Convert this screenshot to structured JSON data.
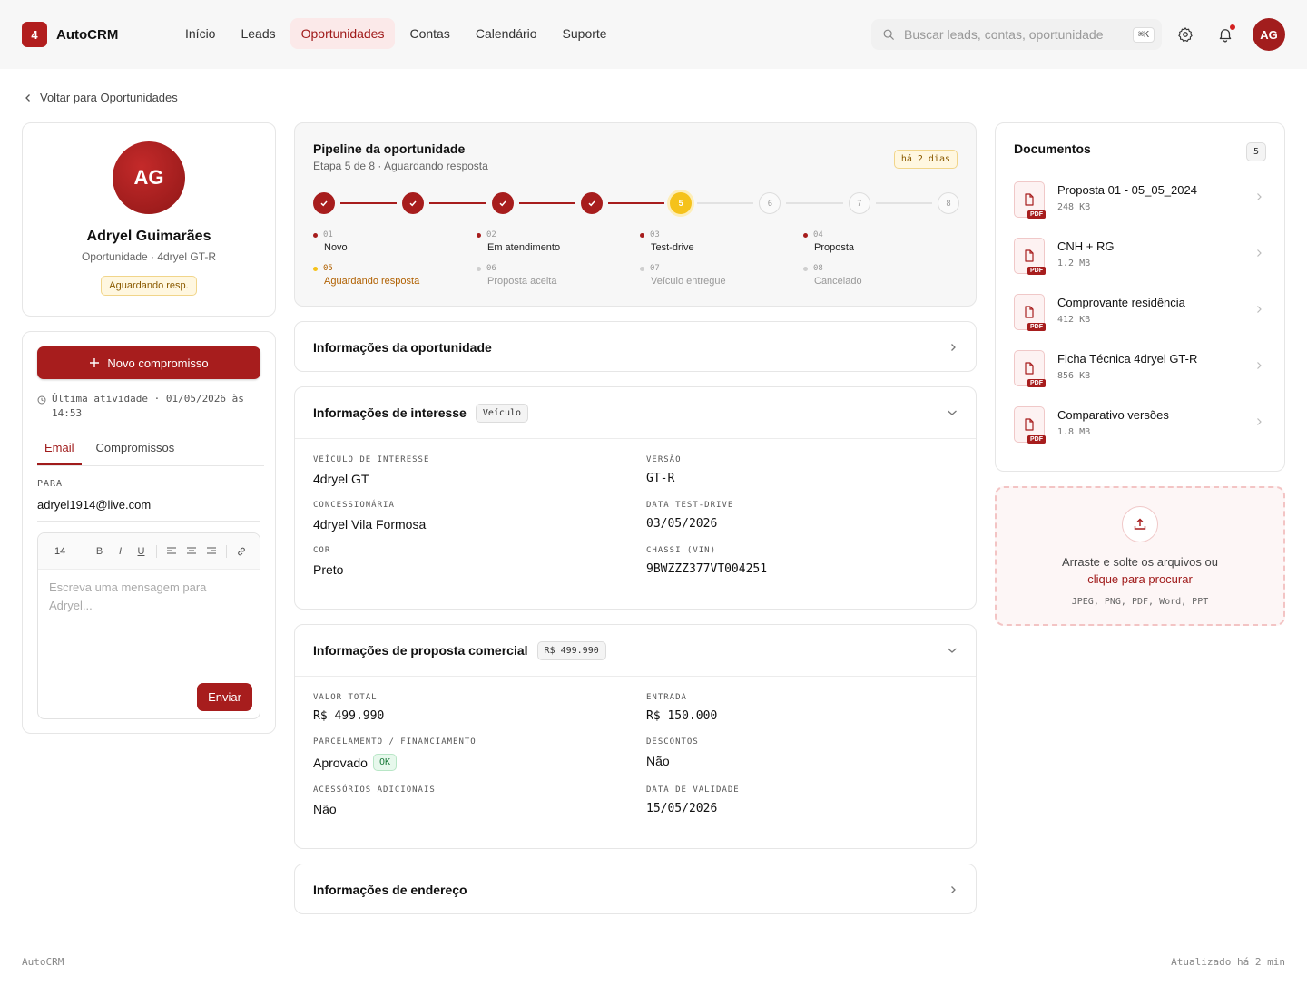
{
  "brand": {
    "logo": "4",
    "name": "AutoCRM"
  },
  "nav": [
    "Início",
    "Leads",
    "Oportunidades",
    "Contas",
    "Calendário",
    "Suporte"
  ],
  "nav_active": "Oportunidades",
  "search": {
    "placeholder": "Buscar leads, contas, oportunidade",
    "shortcut": "⌘K"
  },
  "user": {
    "initials": "AG"
  },
  "back": {
    "label": "Voltar para Oportunidades"
  },
  "profile": {
    "initials": "AG",
    "name": "Adryel Guimarães",
    "subtitle": "Oportunidade · 4dryel GT-R",
    "status": "Aguardando resp."
  },
  "compose": {
    "new_button": "Novo compromisso",
    "last_activity": "Última atividade · 01/05/2026 às 14:53",
    "tabs": [
      "Email",
      "Compromissos"
    ],
    "to_label": "PARA",
    "to_value": "adryel1914@live.com",
    "font_size": "14",
    "toolbar": [
      "B",
      "I",
      "U"
    ],
    "placeholder": "Escreva uma mensagem para Adryel...",
    "send": "Enviar"
  },
  "pipeline": {
    "title": "Pipeline da oportunidade",
    "subtitle": "Etapa 5 de 8 · Aguardando resposta",
    "badge": "há 2 dias",
    "current_step": 5,
    "steps": [
      "1",
      "2",
      "3",
      "4",
      "5",
      "6",
      "7",
      "8"
    ],
    "stages": [
      {
        "num": "01",
        "name": "Novo"
      },
      {
        "num": "02",
        "name": "Em atendimento"
      },
      {
        "num": "03",
        "name": "Test-drive"
      },
      {
        "num": "04",
        "name": "Proposta"
      },
      {
        "num": "05",
        "name": "Aguardando resposta"
      },
      {
        "num": "06",
        "name": "Proposta aceita"
      },
      {
        "num": "07",
        "name": "Veículo entregue"
      },
      {
        "num": "08",
        "name": "Cancelado"
      }
    ]
  },
  "sections": {
    "oportunidade": {
      "title": "Informações da oportunidade"
    },
    "interesse": {
      "title": "Informações de interesse",
      "tag": "Veículo",
      "fields": [
        {
          "label": "VEÍCULO DE INTERESSE",
          "value": "4dryel GT"
        },
        {
          "label": "VERSÃO",
          "value": "GT-R"
        },
        {
          "label": "CONCESSIONÁRIA",
          "value": "4dryel Vila Formosa"
        },
        {
          "label": "DATA TEST-DRIVE",
          "value": "03/05/2026"
        },
        {
          "label": "COR",
          "value": "Preto"
        },
        {
          "label": "CHASSI (VIN)",
          "value": "9BWZZZ377VT004251"
        }
      ]
    },
    "proposta": {
      "title": "Informações de proposta comercial",
      "tag": "R$ 499.990",
      "fields": [
        {
          "label": "VALOR TOTAL",
          "value": "R$ 499.990"
        },
        {
          "label": "ENTRADA",
          "value": "R$ 150.000"
        },
        {
          "label": "PARCELAMENTO / FINANCIAMENTO",
          "value": "Aprovado",
          "badge": "OK"
        },
        {
          "label": "DESCONTOS",
          "value": "Não"
        },
        {
          "label": "ACESSÓRIOS ADICIONAIS",
          "value": "Não"
        },
        {
          "label": "DATA DE VALIDADE",
          "value": "15/05/2026"
        }
      ]
    },
    "endereco": {
      "title": "Informações de endereço"
    }
  },
  "documents": {
    "title": "Documentos",
    "count": "5",
    "items": [
      {
        "name": "Proposta 01 - 05_05_2024",
        "size": "248 KB",
        "type": "PDF"
      },
      {
        "name": "CNH + RG",
        "size": "1.2 MB",
        "type": "PDF"
      },
      {
        "name": "Comprovante residência",
        "size": "412 KB",
        "type": "PDF"
      },
      {
        "name": "Ficha Técnica 4dryel GT-R",
        "size": "856 KB",
        "type": "PDF"
      },
      {
        "name": "Comparativo versões",
        "size": "1.8 MB",
        "type": "PDF"
      }
    ]
  },
  "upload": {
    "text": "Arraste e solte os arquivos ou",
    "link": "clique para procurar",
    "types": "JPEG, PNG, PDF, Word, PPT"
  },
  "footer": {
    "left": "AutoCRM",
    "right": "Atualizado há 2 min"
  },
  "colors": {
    "accent": "#a71d1d",
    "current": "#f5c21b"
  }
}
